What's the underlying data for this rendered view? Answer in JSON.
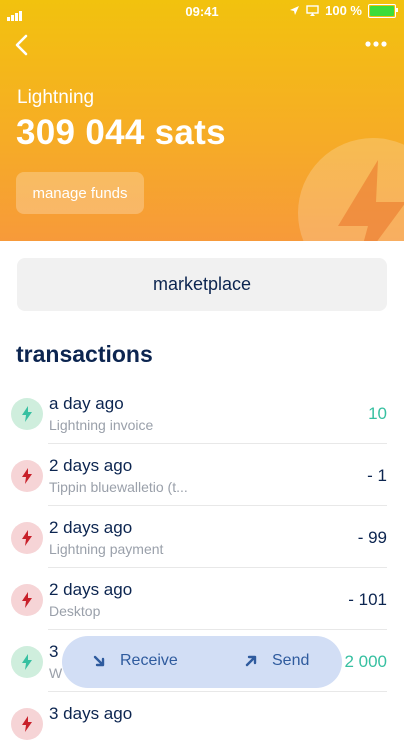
{
  "status_bar": {
    "time": "09:41",
    "battery_text": "100 %"
  },
  "header": {
    "wallet_type": "Lightning",
    "balance": "309 044 sats",
    "manage_label": "manage funds",
    "accent_top": "#f2c20e",
    "accent_bottom": "#f79a3a"
  },
  "marketplace_label": "marketplace",
  "transactions_title": "transactions",
  "transactions": [
    {
      "when": "a day ago",
      "memo": "Lightning invoice",
      "amount": "10",
      "direction": "in"
    },
    {
      "when": "2 days ago",
      "memo": "Tippin bluewalletio (t...",
      "amount": "- 1",
      "direction": "out"
    },
    {
      "when": "2 days ago",
      "memo": "Lightning payment",
      "amount": "- 99",
      "direction": "out"
    },
    {
      "when": "2 days ago",
      "memo": "Desktop",
      "amount": "- 101",
      "direction": "out"
    },
    {
      "when": "3",
      "memo": "W",
      "amount": "2 000",
      "direction": "in"
    },
    {
      "when": "3 days ago",
      "memo": "",
      "amount": "",
      "direction": "out"
    }
  ],
  "actions": {
    "receive_label": "Receive",
    "send_label": "Send"
  },
  "colors": {
    "incoming": "#37c0a1",
    "outgoing_icon": "#c8202a",
    "incoming_icon": "#37c0a1"
  }
}
